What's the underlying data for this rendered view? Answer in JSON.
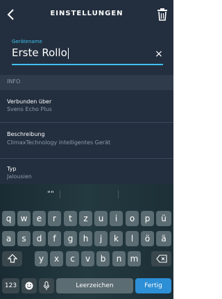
{
  "header": {
    "title": "EINSTELLUNGEN",
    "back_icon": "chevron-left-icon",
    "delete_icon": "trash-icon"
  },
  "name_field": {
    "label": "Gerätename",
    "value": "Erste Rollo",
    "clear_icon": "close-icon"
  },
  "info_section": {
    "title": "INFO",
    "items": [
      {
        "label": "Verbunden über",
        "value": "Svens Echo Plus"
      },
      {
        "label": "Beschreibung",
        "value": "ClimaxTechnology intelligentes Gerät"
      },
      {
        "label": "Typ",
        "value": "Jalousien"
      }
    ]
  },
  "keyboard": {
    "suggestion": "\"\"",
    "row1": [
      "q",
      "w",
      "e",
      "r",
      "t",
      "z",
      "u",
      "i",
      "o",
      "p",
      "ü"
    ],
    "row2": [
      "a",
      "s",
      "d",
      "f",
      "g",
      "h",
      "j",
      "k",
      "l",
      "ö",
      "ä"
    ],
    "row3": [
      "y",
      "x",
      "c",
      "v",
      "b",
      "n",
      "m"
    ],
    "shift_icon": "shift-icon",
    "backspace_icon": "backspace-icon",
    "numbers_label": "123",
    "emoji_icon": "emoji-icon",
    "mic_icon": "microphone-icon",
    "space_label": "Leerzeichen",
    "done_label": "Fertig"
  },
  "colors": {
    "background": "#232f3e",
    "accent": "#3ec0ef",
    "action_key": "#2d8fd5"
  }
}
